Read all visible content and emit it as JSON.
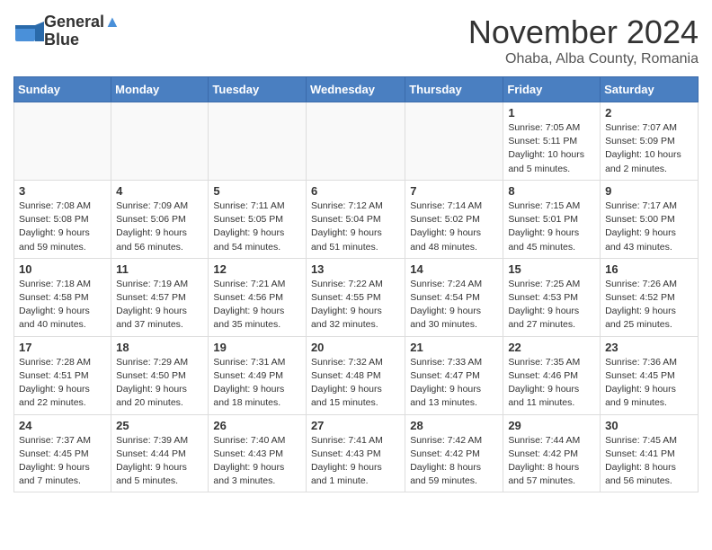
{
  "logo": {
    "line1": "General",
    "line2": "Blue"
  },
  "title": "November 2024",
  "location": "Ohaba, Alba County, Romania",
  "weekdays": [
    "Sunday",
    "Monday",
    "Tuesday",
    "Wednesday",
    "Thursday",
    "Friday",
    "Saturday"
  ],
  "weeks": [
    [
      {
        "day": "",
        "info": ""
      },
      {
        "day": "",
        "info": ""
      },
      {
        "day": "",
        "info": ""
      },
      {
        "day": "",
        "info": ""
      },
      {
        "day": "",
        "info": ""
      },
      {
        "day": "1",
        "info": "Sunrise: 7:05 AM\nSunset: 5:11 PM\nDaylight: 10 hours\nand 5 minutes."
      },
      {
        "day": "2",
        "info": "Sunrise: 7:07 AM\nSunset: 5:09 PM\nDaylight: 10 hours\nand 2 minutes."
      }
    ],
    [
      {
        "day": "3",
        "info": "Sunrise: 7:08 AM\nSunset: 5:08 PM\nDaylight: 9 hours\nand 59 minutes."
      },
      {
        "day": "4",
        "info": "Sunrise: 7:09 AM\nSunset: 5:06 PM\nDaylight: 9 hours\nand 56 minutes."
      },
      {
        "day": "5",
        "info": "Sunrise: 7:11 AM\nSunset: 5:05 PM\nDaylight: 9 hours\nand 54 minutes."
      },
      {
        "day": "6",
        "info": "Sunrise: 7:12 AM\nSunset: 5:04 PM\nDaylight: 9 hours\nand 51 minutes."
      },
      {
        "day": "7",
        "info": "Sunrise: 7:14 AM\nSunset: 5:02 PM\nDaylight: 9 hours\nand 48 minutes."
      },
      {
        "day": "8",
        "info": "Sunrise: 7:15 AM\nSunset: 5:01 PM\nDaylight: 9 hours\nand 45 minutes."
      },
      {
        "day": "9",
        "info": "Sunrise: 7:17 AM\nSunset: 5:00 PM\nDaylight: 9 hours\nand 43 minutes."
      }
    ],
    [
      {
        "day": "10",
        "info": "Sunrise: 7:18 AM\nSunset: 4:58 PM\nDaylight: 9 hours\nand 40 minutes."
      },
      {
        "day": "11",
        "info": "Sunrise: 7:19 AM\nSunset: 4:57 PM\nDaylight: 9 hours\nand 37 minutes."
      },
      {
        "day": "12",
        "info": "Sunrise: 7:21 AM\nSunset: 4:56 PM\nDaylight: 9 hours\nand 35 minutes."
      },
      {
        "day": "13",
        "info": "Sunrise: 7:22 AM\nSunset: 4:55 PM\nDaylight: 9 hours\nand 32 minutes."
      },
      {
        "day": "14",
        "info": "Sunrise: 7:24 AM\nSunset: 4:54 PM\nDaylight: 9 hours\nand 30 minutes."
      },
      {
        "day": "15",
        "info": "Sunrise: 7:25 AM\nSunset: 4:53 PM\nDaylight: 9 hours\nand 27 minutes."
      },
      {
        "day": "16",
        "info": "Sunrise: 7:26 AM\nSunset: 4:52 PM\nDaylight: 9 hours\nand 25 minutes."
      }
    ],
    [
      {
        "day": "17",
        "info": "Sunrise: 7:28 AM\nSunset: 4:51 PM\nDaylight: 9 hours\nand 22 minutes."
      },
      {
        "day": "18",
        "info": "Sunrise: 7:29 AM\nSunset: 4:50 PM\nDaylight: 9 hours\nand 20 minutes."
      },
      {
        "day": "19",
        "info": "Sunrise: 7:31 AM\nSunset: 4:49 PM\nDaylight: 9 hours\nand 18 minutes."
      },
      {
        "day": "20",
        "info": "Sunrise: 7:32 AM\nSunset: 4:48 PM\nDaylight: 9 hours\nand 15 minutes."
      },
      {
        "day": "21",
        "info": "Sunrise: 7:33 AM\nSunset: 4:47 PM\nDaylight: 9 hours\nand 13 minutes."
      },
      {
        "day": "22",
        "info": "Sunrise: 7:35 AM\nSunset: 4:46 PM\nDaylight: 9 hours\nand 11 minutes."
      },
      {
        "day": "23",
        "info": "Sunrise: 7:36 AM\nSunset: 4:45 PM\nDaylight: 9 hours\nand 9 minutes."
      }
    ],
    [
      {
        "day": "24",
        "info": "Sunrise: 7:37 AM\nSunset: 4:45 PM\nDaylight: 9 hours\nand 7 minutes."
      },
      {
        "day": "25",
        "info": "Sunrise: 7:39 AM\nSunset: 4:44 PM\nDaylight: 9 hours\nand 5 minutes."
      },
      {
        "day": "26",
        "info": "Sunrise: 7:40 AM\nSunset: 4:43 PM\nDaylight: 9 hours\nand 3 minutes."
      },
      {
        "day": "27",
        "info": "Sunrise: 7:41 AM\nSunset: 4:43 PM\nDaylight: 9 hours\nand 1 minute."
      },
      {
        "day": "28",
        "info": "Sunrise: 7:42 AM\nSunset: 4:42 PM\nDaylight: 8 hours\nand 59 minutes."
      },
      {
        "day": "29",
        "info": "Sunrise: 7:44 AM\nSunset: 4:42 PM\nDaylight: 8 hours\nand 57 minutes."
      },
      {
        "day": "30",
        "info": "Sunrise: 7:45 AM\nSunset: 4:41 PM\nDaylight: 8 hours\nand 56 minutes."
      }
    ]
  ]
}
